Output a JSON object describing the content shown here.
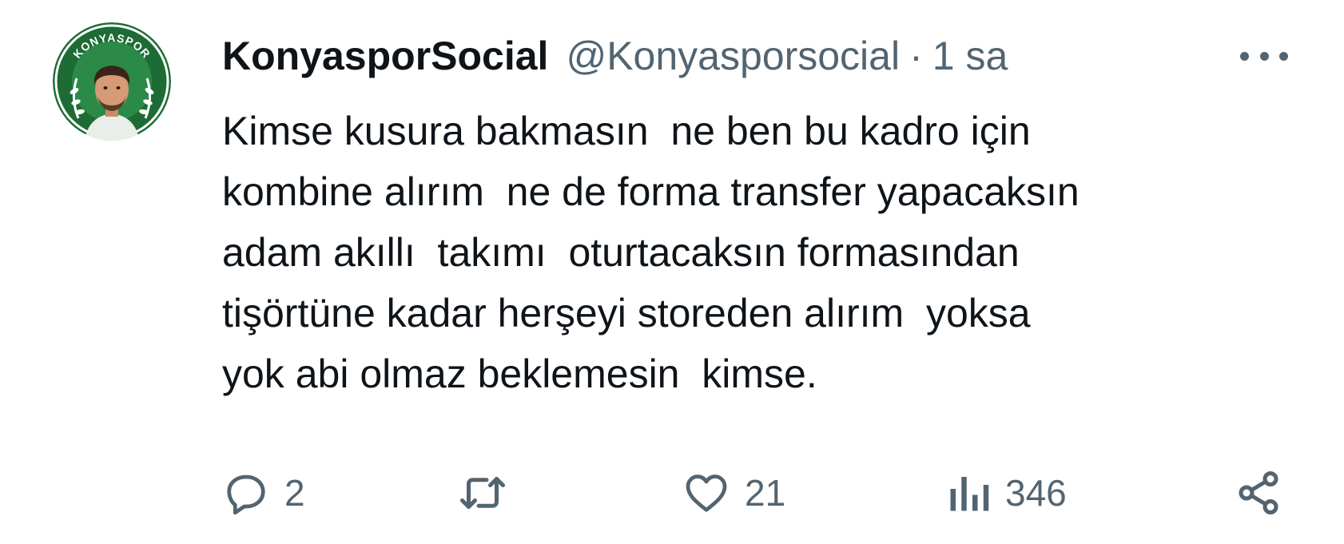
{
  "tweet": {
    "author": {
      "display_name": "KonyasporSocial",
      "handle": "@Konyasporsocial",
      "avatar_badge_text": "KONYASPOR"
    },
    "separator": "·",
    "time": "1 sa",
    "text_lines": [
      "Kimse kusura bakmasın  ne ben bu kadro için",
      "kombine alırım  ne de forma transfer yapacaksın",
      "adam akıllı  takımı  oturtacaksın formasından",
      "tişörtüne kadar herşeyi storeden alırım  yoksa",
      "yok abi olmaz beklemesin  kimse."
    ],
    "actions": {
      "reply": {
        "icon": "reply-icon",
        "count": "2"
      },
      "retweet": {
        "icon": "retweet-icon",
        "count": ""
      },
      "like": {
        "icon": "heart-icon",
        "count": "21"
      },
      "views": {
        "icon": "views-icon",
        "count": "346"
      },
      "share": {
        "icon": "share-icon"
      }
    },
    "more_icon": "more-icon"
  },
  "colors": {
    "text": "#0f1419",
    "secondary": "#536471",
    "badge_green": "#1d6b35"
  }
}
